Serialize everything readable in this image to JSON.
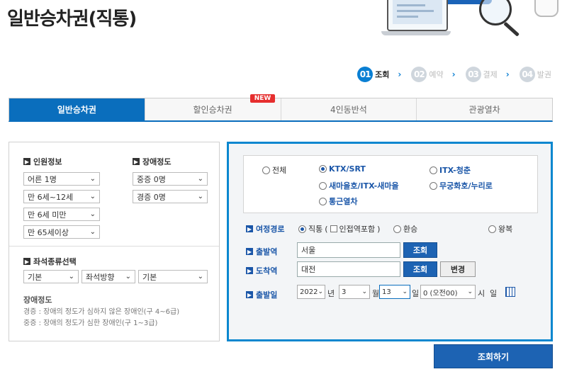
{
  "page": {
    "title": "일반승차권(직통)"
  },
  "steps": [
    {
      "num": "01",
      "label": "조회",
      "active": true
    },
    {
      "num": "02",
      "label": "예약"
    },
    {
      "num": "03",
      "label": "결제"
    },
    {
      "num": "04",
      "label": "발권"
    }
  ],
  "tabs": [
    {
      "label": "일반승차권",
      "active": true
    },
    {
      "label": "할인승차권",
      "badge": "NEW"
    },
    {
      "label": "4인동반석"
    },
    {
      "label": "관광열차"
    }
  ],
  "passenger": {
    "heading": "인원정보",
    "adult": "어른 1명",
    "child": "만 6세~12세",
    "infant": "만 6세 미만",
    "senior": "만 65세이상"
  },
  "disability": {
    "heading": "장애정도",
    "severe": "중증 0명",
    "mild": "경증 0명"
  },
  "seat": {
    "heading": "좌석종류선택",
    "type": "기본",
    "direction": "좌석방향",
    "option": "기본"
  },
  "note": {
    "title": "장애정도",
    "mild_desc": "경증 : 장애의 정도가 심하지 않은 장애인(구 4~6급)",
    "severe_desc": "중증 : 장애의 정도가 심한 장애인(구 1~3급)"
  },
  "train_types": {
    "all": "전체",
    "ktx": "KTX/SRT",
    "itx_chungchun": "ITX-청춘",
    "saemaeul": "새마을호/ITX-새마을",
    "mugunghwa": "무궁화호/누리로",
    "commuter": "통근열차",
    "selected": "KTX/SRT"
  },
  "route": {
    "label": "여정경로",
    "direct": "직통",
    "include_nearby": "인접역포함",
    "transfer": "환승",
    "round_trip": "왕복"
  },
  "departure": {
    "label": "출발역",
    "value": "서울",
    "search": "조회"
  },
  "arrival": {
    "label": "도착역",
    "value": "대전",
    "search": "조회",
    "swap": "변경"
  },
  "date": {
    "label": "출발일",
    "year": "2022",
    "year_unit": "년",
    "month": "3",
    "month_unit": "월",
    "day": "13",
    "day_unit": "일",
    "hour": "0 (오전00)",
    "hour_unit": "시",
    "weekday": "일"
  },
  "actions": {
    "search_label": "조회하기"
  }
}
